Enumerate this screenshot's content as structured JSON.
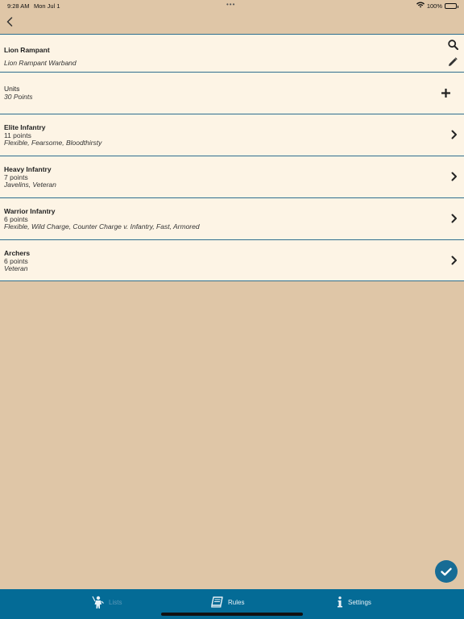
{
  "status": {
    "time": "9:28 AM",
    "date": "Mon Jul 1",
    "battery": "100%",
    "battery_level": 1.0
  },
  "header_item": {
    "title": "Lion Rampant",
    "subtitle": "Lion Rampant Warband"
  },
  "units_header": {
    "title": "Units",
    "points": "30 Points"
  },
  "units": [
    {
      "name": "Elite Infantry",
      "points": "11 points",
      "traits": "Flexible, Fearsome, Bloodthirsty"
    },
    {
      "name": "Heavy Infantry",
      "points": "7 points",
      "traits": "Javelins, Veteran"
    },
    {
      "name": "Warrior Infantry",
      "points": "6 points",
      "traits": "Flexible, Wild Charge, Counter Charge v. Infantry, Fast, Armored"
    },
    {
      "name": "Archers",
      "points": "6 points",
      "traits": "Veteran"
    }
  ],
  "tabs": [
    {
      "label": "Lists",
      "icon": "warrior-icon"
    },
    {
      "label": "Rules",
      "icon": "book-icon"
    },
    {
      "label": "Settings",
      "icon": "info-icon"
    }
  ],
  "colors": {
    "background": "#dfc6a7",
    "row": "#fdf4e5",
    "accent": "#046b96",
    "divider": "#2e6f8f"
  }
}
